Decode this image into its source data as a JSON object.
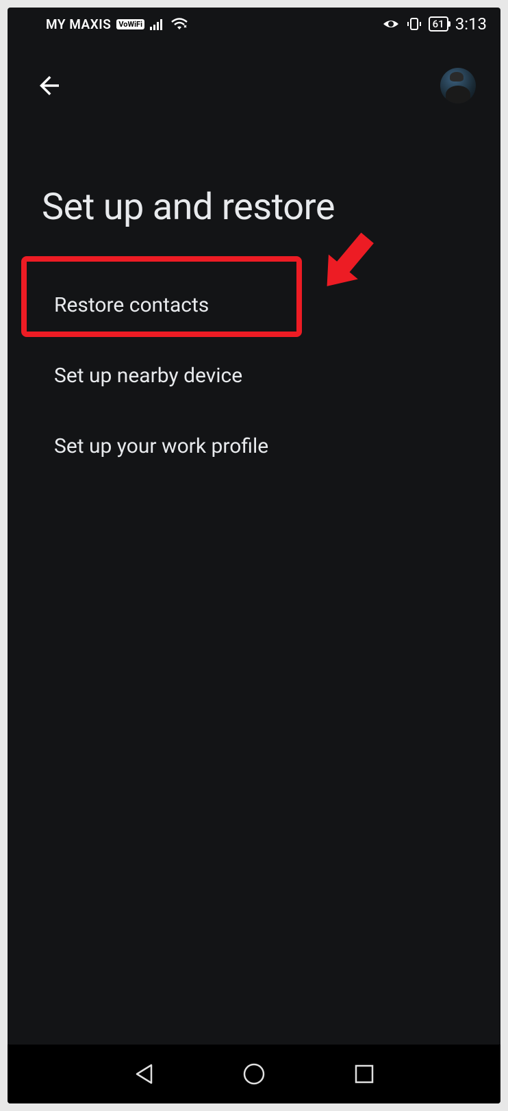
{
  "statusBar": {
    "carrier": "MY MAXIS",
    "vowifi": "VoWiFi",
    "battery": "61",
    "time": "3:13"
  },
  "page": {
    "title": "Set up and restore"
  },
  "menu": {
    "items": [
      "Restore contacts",
      "Set up nearby device",
      "Set up your work profile"
    ]
  },
  "annotation": {
    "highlightedIndex": 0
  }
}
